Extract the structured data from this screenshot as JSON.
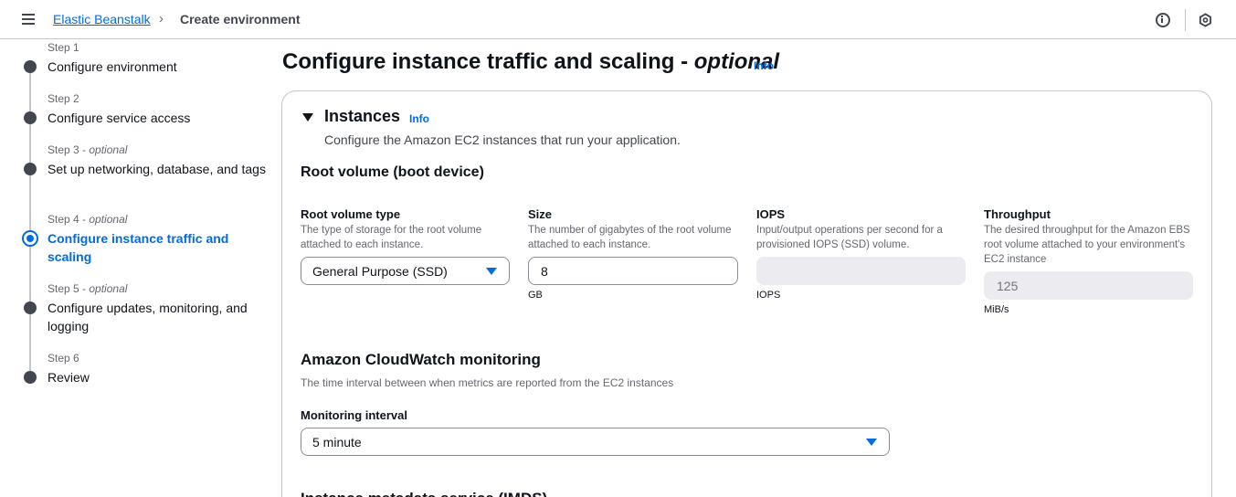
{
  "header": {
    "breadcrumb_root": "Elastic Beanstalk",
    "breadcrumb_separator": ">",
    "breadcrumb_current": "Create environment",
    "icons": [
      "menu-icon",
      "info-icon",
      "settings-hexagon-icon"
    ]
  },
  "steps": [
    {
      "label": "Step 1",
      "optional": "",
      "title": "Configure environment",
      "state": "done"
    },
    {
      "label": "Step 2",
      "optional": "",
      "title": "Configure service access",
      "state": "done"
    },
    {
      "label": "Step 3",
      "optional": "optional",
      "title": "Set up networking, database, and tags",
      "state": "done"
    },
    {
      "label": "Step 4",
      "optional": "optional",
      "title": "Configure instance traffic and scaling",
      "state": "active"
    },
    {
      "label": "Step 5",
      "optional": "optional",
      "title": "Configure updates, monitoring, and logging",
      "state": "pending"
    },
    {
      "label": "Step 6",
      "optional": "",
      "title": "Review",
      "state": "pending"
    }
  ],
  "page": {
    "title": "Configure instance traffic and scaling",
    "title_suffix": "optional",
    "info": "Info"
  },
  "instances": {
    "title": "Instances",
    "info": "Info",
    "description": "Configure the Amazon EC2 instances that run your application.",
    "root_volume": {
      "heading": "Root volume (boot device)",
      "type": {
        "label": "Root volume type",
        "description": "The type of storage for the root volume attached to each instance.",
        "value": "General Purpose (SSD)"
      },
      "size": {
        "label": "Size",
        "description": "The number of gigabytes of the root volume attached to each instance.",
        "value": "8",
        "unit": "GB"
      },
      "iops": {
        "label": "IOPS",
        "description": "Input/output operations per second for a provisioned IOPS (SSD) volume.",
        "value": "",
        "unit": "IOPS"
      },
      "throughput": {
        "label": "Throughput",
        "description": "The desired throughput for the Amazon EBS root volume attached to your environment's EC2 instance",
        "placeholder": "125",
        "unit": "MiB/s"
      }
    },
    "cloudwatch": {
      "heading": "Amazon CloudWatch monitoring",
      "description": "The time interval between when metrics are reported from the EC2 instances",
      "interval_label": "Monitoring interval",
      "interval_value": "5 minute"
    },
    "imds_heading": "Instance metadata service (IMDS)"
  },
  "colors": {
    "accent": "#006ce0",
    "text": "#0f141a",
    "muted": "#656871",
    "border": "#c6c6cd"
  }
}
